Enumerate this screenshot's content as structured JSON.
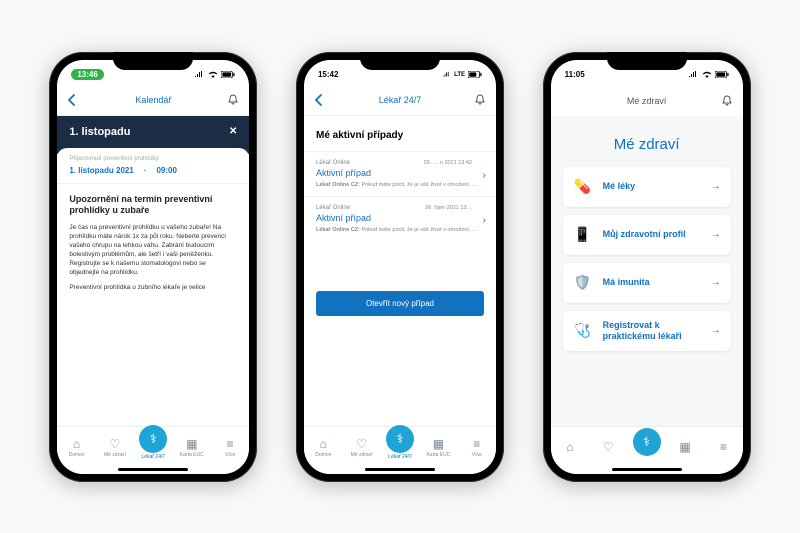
{
  "phone1": {
    "status_time": "13:46",
    "header_title": "Kalendář",
    "banner_date": "1. listopadu",
    "banner_close": "✕",
    "sched_label": "Připomenutí preventivní prohlídky",
    "sched_date": "1. listopadu 2021",
    "sched_sep": "·",
    "sched_time": "09:00",
    "card_title": "Upozornění na termín preventivní prohlídky u zubaře",
    "card_p1": "Je čas na preventivní prohlídku u vašeho zubaře! Na prohlídku máte nárok 1x za půl roku. Neberte prevenci vašeho chrupu na lehkou váhu. Zabrání budoucím bolestivým problémům, ale šetří i vaši peněženku. Registrujte se k našemu stomatologovi nebo se objednejte na prohlídku.",
    "card_p2": "Preventivní prohlídka u zubního lékaře je velice"
  },
  "phone2": {
    "status_time": "15:42",
    "status_net": "LTE",
    "header_title": "Lékař 24/7",
    "section_title": "Mé aktivní případy",
    "cases": [
      {
        "src": "Lékař Online",
        "name": "Aktivní případ",
        "date": "26. … n 2021 13:42",
        "msg_src": "Lékař Online CZ:",
        "msg": "Pokud máte pocit, že je váš život v ohrožení, …"
      },
      {
        "src": "Lékař Online",
        "name": "Aktivní případ",
        "date": "26. říjen 2021 13…",
        "msg_src": "Lékař Online CZ:",
        "msg": "Pokud máte pocit, že je váš život v ohrožení, …"
      }
    ],
    "cta_label": "Otevřít nový případ"
  },
  "phone3": {
    "status_time": "11:05",
    "header_title": "Mé zdraví",
    "big_title": "Mé zdraví",
    "items": [
      {
        "label": "Mé léky",
        "icon": "💊"
      },
      {
        "label": "Můj zdravotní profil",
        "icon": "📱"
      },
      {
        "label": "Má imunita",
        "icon": "🛡️"
      },
      {
        "label": "Registrovat k praktickému lékaři",
        "icon": "🩺"
      }
    ]
  },
  "nav": {
    "items": [
      {
        "label": "Domov"
      },
      {
        "label": "Mé zdraví"
      },
      {
        "label": "Lékař 24/7"
      },
      {
        "label": "Karta EUC"
      },
      {
        "label": "Více"
      }
    ]
  }
}
